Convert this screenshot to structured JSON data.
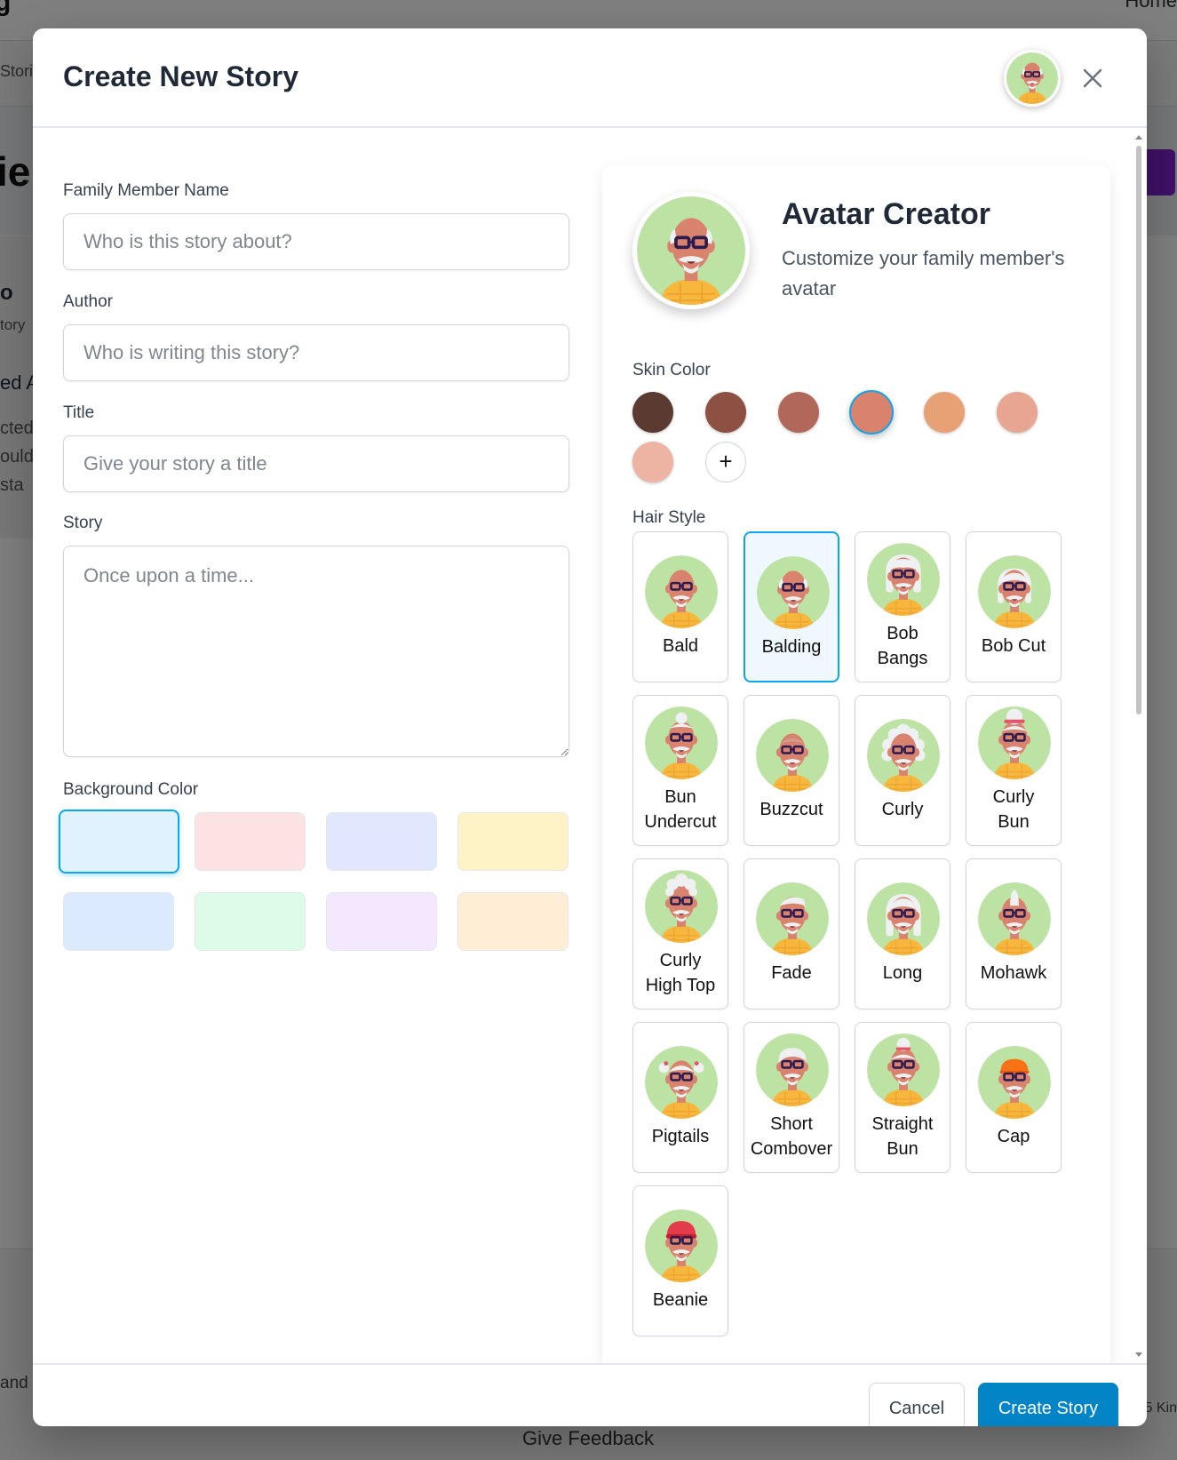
{
  "background": {
    "corner_letter": "g",
    "nav_home": "Home",
    "breadcrumb": "Stori",
    "hero_fragment": "ie",
    "card_title_fragment": "o",
    "card_sub_fragment": "tory",
    "card_heading_fragment": "ed A",
    "card_lines": [
      "cted",
      "ould",
      "sta"
    ],
    "footer_left_fragment": "and p",
    "footer_right_fragment": "5 Kin",
    "give_feedback": "Give Feedback"
  },
  "modal": {
    "title": "Create New Story",
    "close_icon": "close-icon"
  },
  "form": {
    "name_label": "Family Member Name",
    "name_placeholder": "Who is this story about?",
    "author_label": "Author",
    "author_placeholder": "Who is writing this story?",
    "title_label": "Title",
    "title_placeholder": "Give your story a title",
    "story_label": "Story",
    "story_placeholder": "Once upon a time...",
    "bg_color_label": "Background Color",
    "bg_colors": [
      "#e0f2fe",
      "#fde2e4",
      "#e0e7ff",
      "#fef3c7",
      "#dbeafe",
      "#dcfce7",
      "#f3e8ff",
      "#ffedd5"
    ],
    "bg_selected_index": 0
  },
  "avatar": {
    "title": "Avatar Creator",
    "subtitle": "Customize your family member's avatar",
    "skin_label": "Skin Color",
    "skin_colors": [
      "#5b3a32",
      "#8d5143",
      "#b1685a",
      "#d9826e",
      "#e8a075",
      "#e8a592",
      "#edb3a3"
    ],
    "skin_selected_index": 3,
    "add_skin_label": "+",
    "hair_label": "Hair Style",
    "hair_selected": "Balding",
    "hair_styles": [
      {
        "label": "Bald",
        "lines": [
          "Bald"
        ]
      },
      {
        "label": "Balding",
        "lines": [
          "Balding"
        ]
      },
      {
        "label": "Bob Bangs",
        "lines": [
          "Bob",
          "Bangs"
        ]
      },
      {
        "label": "Bob Cut",
        "lines": [
          "Bob Cut"
        ]
      },
      {
        "label": "Bun Undercut",
        "lines": [
          "Bun",
          "Undercut"
        ]
      },
      {
        "label": "Buzzcut",
        "lines": [
          "Buzzcut"
        ]
      },
      {
        "label": "Curly",
        "lines": [
          "Curly"
        ]
      },
      {
        "label": "Curly Bun",
        "lines": [
          "Curly",
          "Bun"
        ]
      },
      {
        "label": "Curly High Top",
        "lines": [
          "Curly",
          "High Top"
        ]
      },
      {
        "label": "Fade",
        "lines": [
          "Fade"
        ]
      },
      {
        "label": "Long",
        "lines": [
          "Long"
        ]
      },
      {
        "label": "Mohawk",
        "lines": [
          "Mohawk"
        ]
      },
      {
        "label": "Pigtails",
        "lines": [
          "Pigtails"
        ]
      },
      {
        "label": "Short Combover",
        "lines": [
          "Short",
          "Combover"
        ]
      },
      {
        "label": "Straight Bun",
        "lines": [
          "Straight",
          "Bun"
        ]
      },
      {
        "label": "Cap",
        "lines": [
          "Cap"
        ]
      },
      {
        "label": "Beanie",
        "lines": [
          "Beanie"
        ]
      }
    ]
  },
  "footer": {
    "cancel_label": "Cancel",
    "create_label": "Create Story"
  },
  "colors": {
    "accent": "#0284c7",
    "selection_border": "#0ea5e9",
    "avatar_bg": "#bde3a4",
    "shirt": "#f6b73c",
    "hair_white": "#eef0f2"
  }
}
